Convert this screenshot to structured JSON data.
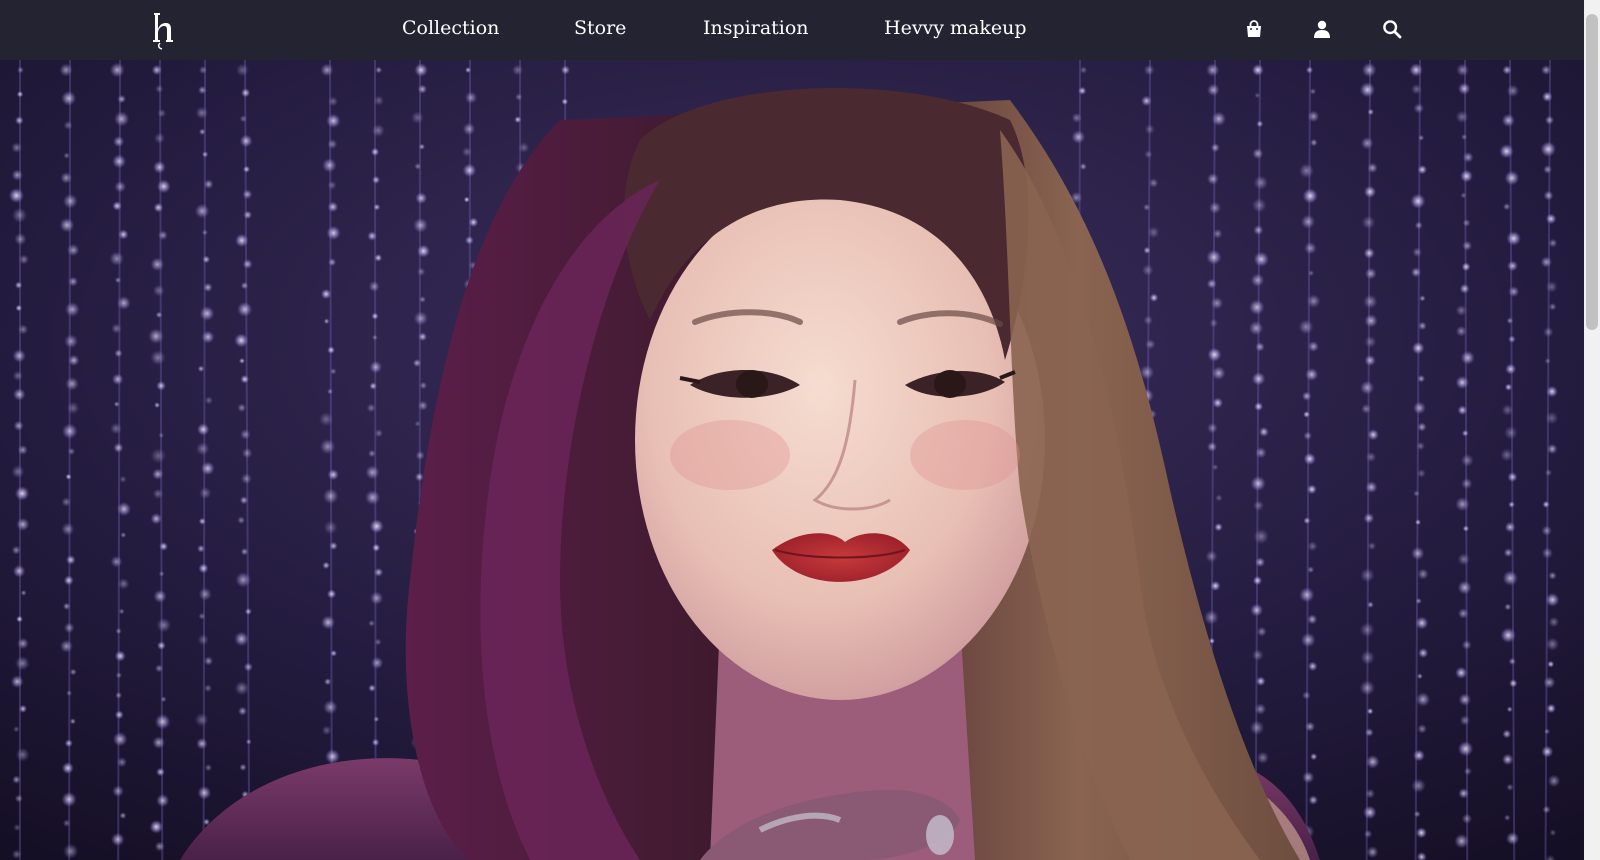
{
  "header": {
    "logo_icon": "brand-h-logo-icon",
    "nav_items": [
      {
        "label": "Collection"
      },
      {
        "label": "Store"
      },
      {
        "label": "Inspiration"
      },
      {
        "label": "Hevvy makeup"
      }
    ],
    "icons": [
      "shopping-bag-icon",
      "user-icon",
      "search-icon"
    ]
  },
  "hero": {
    "image_subject": "portrait-with-crystal-curtain"
  },
  "colors": {
    "nav_background": "#242332",
    "nav_text": "#ffffff",
    "hero_background": "#201a36",
    "crystal_violet": "#8f78e8"
  }
}
